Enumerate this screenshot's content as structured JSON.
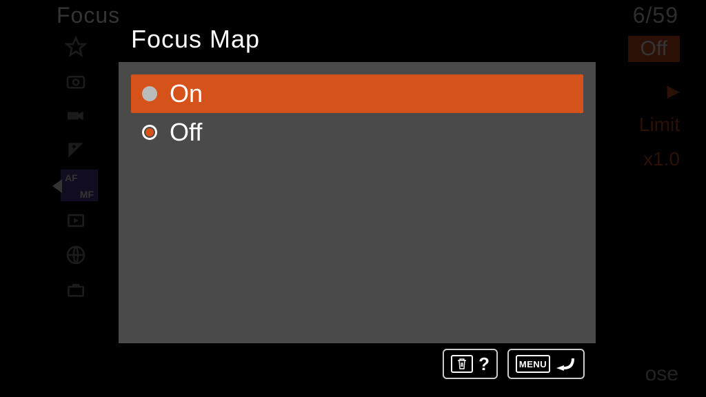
{
  "background": {
    "title": "Focus",
    "page_counter": "6/59",
    "right": {
      "off_label": "Off",
      "limit_label": "Limit",
      "x10_label": "x1.0"
    },
    "close_label": "ose"
  },
  "modal": {
    "title": "Focus Map",
    "options": [
      {
        "label": "On",
        "highlighted": true,
        "checked": false
      },
      {
        "label": "Off",
        "highlighted": false,
        "checked": true
      }
    ],
    "footer": {
      "menu_label": "MENU"
    }
  }
}
